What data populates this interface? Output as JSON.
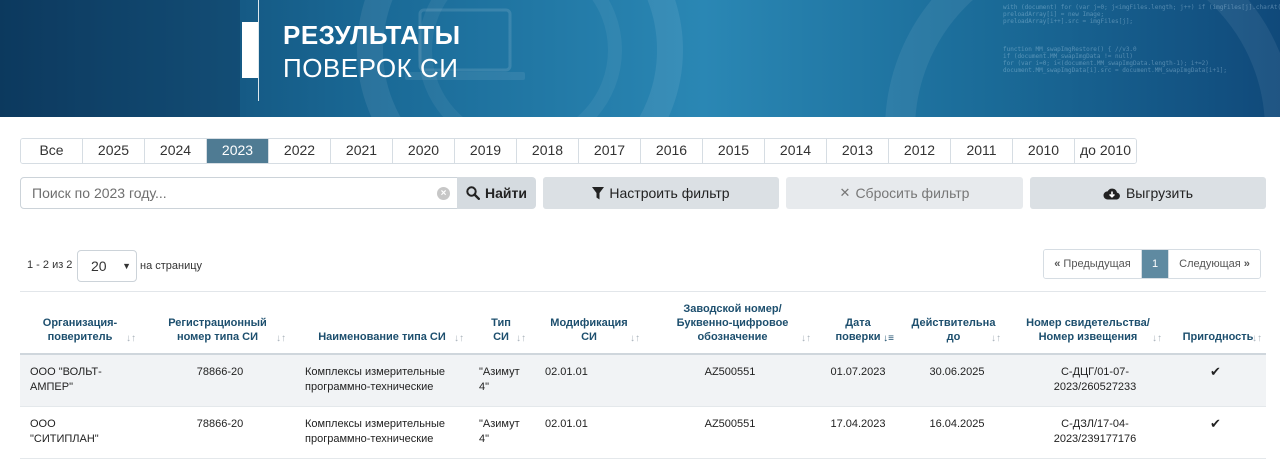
{
  "header": {
    "title_line1": "РЕЗУЛЬТАТЫ",
    "title_line2": "ПОВЕРОК СИ"
  },
  "year_tabs": [
    {
      "label": "Все",
      "active": false
    },
    {
      "label": "2025",
      "active": false
    },
    {
      "label": "2024",
      "active": false
    },
    {
      "label": "2023",
      "active": true
    },
    {
      "label": "2022",
      "active": false
    },
    {
      "label": "2021",
      "active": false
    },
    {
      "label": "2020",
      "active": false
    },
    {
      "label": "2019",
      "active": false
    },
    {
      "label": "2018",
      "active": false
    },
    {
      "label": "2017",
      "active": false
    },
    {
      "label": "2016",
      "active": false
    },
    {
      "label": "2015",
      "active": false
    },
    {
      "label": "2014",
      "active": false
    },
    {
      "label": "2013",
      "active": false
    },
    {
      "label": "2012",
      "active": false
    },
    {
      "label": "2011",
      "active": false
    },
    {
      "label": "2010",
      "active": false
    },
    {
      "label": "до 2010",
      "active": false
    }
  ],
  "search": {
    "placeholder": "Поиск по 2023 году...",
    "value": "",
    "search_label": "Найти"
  },
  "toolbar": {
    "filter_label": "Настроить фильтр",
    "reset_label": "Сбросить фильтр",
    "export_label": "Выгрузить"
  },
  "pagination": {
    "count_text": "1 - 2 из 2",
    "per_page_value": "20",
    "per_page_label": "на страницу",
    "prev_label": "Предыдущая",
    "current_page": "1",
    "next_label": "Следующая"
  },
  "table": {
    "columns": [
      {
        "key": "org",
        "label": "Организация-\nповеритель",
        "sort": "none"
      },
      {
        "key": "reg",
        "label": "Регистрационный\nномер типа СИ",
        "sort": "none"
      },
      {
        "key": "name",
        "label": "Наименование типа СИ",
        "sort": "none"
      },
      {
        "key": "type",
        "label": "Тип\nСИ",
        "sort": "none"
      },
      {
        "key": "mod",
        "label": "Модификация\nСИ",
        "sort": "none"
      },
      {
        "key": "serial",
        "label": "Заводской номер/\nБуквенно-цифровое\nобозначение",
        "sort": "none"
      },
      {
        "key": "date",
        "label": "Дата\nповерки",
        "sort": "desc"
      },
      {
        "key": "valid",
        "label": "Действительна\nдо",
        "sort": "none"
      },
      {
        "key": "cert",
        "label": "Номер свидетельства/\nНомер извещения",
        "sort": "none"
      },
      {
        "key": "fit",
        "label": "Пригодность",
        "sort": "none"
      }
    ],
    "rows": [
      {
        "org": "ООО \"ВОЛЬТ-\nАМПЕР\"",
        "reg": "78866-20",
        "name": "Комплексы измерительные\nпрограммно-технические",
        "type": "\"Азимут\n4\"",
        "mod": "02.01.01",
        "serial": "AZ500551",
        "date": "01.07.2023",
        "valid": "30.06.2025",
        "cert": "С-ДЦГ/01-07-\n2023/260527233",
        "fit": true
      },
      {
        "org": "ООО\n\"СИТИПЛАН\"",
        "reg": "78866-20",
        "name": "Комплексы измерительные\nпрограммно-технические",
        "type": "\"Азимут\n4\"",
        "mod": "02.01.01",
        "serial": "AZ500551",
        "date": "17.04.2023",
        "valid": "16.04.2025",
        "cert": "С-ДЗЛ/17-04-\n2023/239177176",
        "fit": true
      }
    ]
  }
}
